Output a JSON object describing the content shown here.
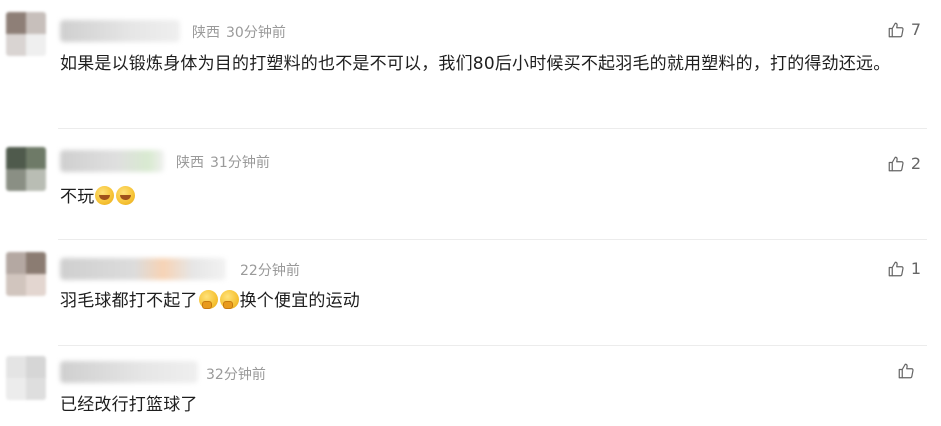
{
  "comments": [
    {
      "location": "陕西",
      "time": "30分钟前",
      "text": "如果是以锻炼身体为目的打塑料的也不是不可以，我们80后小时候买不起羽毛的就用塑料的，打的得劲还远。",
      "likes": "7"
    },
    {
      "location": "陕西",
      "time": "31分钟前",
      "text": "不玩",
      "emoji": [
        "laugh-emoji",
        "laugh-emoji"
      ],
      "likes": "2"
    },
    {
      "location": "",
      "time": "22分钟前",
      "text_before": "羽毛球都打不起了",
      "emoji": [
        "thinking-emoji",
        "thinking-emoji"
      ],
      "text_after": "换个便宜的运动",
      "likes": "1"
    },
    {
      "location": "",
      "time": "32分钟前",
      "text": "已经改行打篮球了",
      "likes": ""
    }
  ],
  "icons": {
    "like": "thumbs-up-icon"
  },
  "colors": {
    "text": "#1e1e1e",
    "meta": "#9a9a9a",
    "icon": "#666666"
  }
}
